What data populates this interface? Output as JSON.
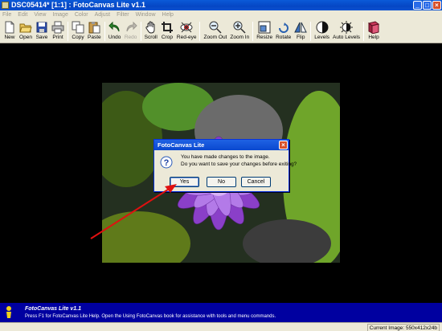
{
  "window": {
    "title": "DSC05414* [1:1] : FotoCanvas Lite v1.1",
    "buttons": [
      "_",
      "□",
      "×"
    ]
  },
  "menu": [
    "File",
    "Edit",
    "View",
    "Image",
    "Color",
    "Adjust",
    "Filter",
    "Window",
    "Help"
  ],
  "toolbar": [
    {
      "label": "New",
      "icon": "new-document-icon"
    },
    {
      "label": "Open",
      "icon": "open-folder-icon"
    },
    {
      "label": "Save",
      "icon": "floppy-disk-icon"
    },
    {
      "label": "Print",
      "icon": "printer-icon"
    },
    {
      "label": "Copy",
      "icon": "copy-icon"
    },
    {
      "label": "Paste",
      "icon": "paste-icon"
    },
    {
      "label": "Undo",
      "icon": "undo-arrow-icon"
    },
    {
      "label": "Redo",
      "icon": "redo-arrow-icon",
      "disabled": true
    },
    {
      "label": "Scroll",
      "icon": "hand-icon"
    },
    {
      "label": "Crop",
      "icon": "crop-icon"
    },
    {
      "label": "Red-eye",
      "icon": "red-eye-icon"
    },
    {
      "label": "Zoom Out",
      "icon": "zoom-out-icon"
    },
    {
      "label": "Zoom In",
      "icon": "zoom-in-icon"
    },
    {
      "label": "Resize",
      "icon": "resize-icon"
    },
    {
      "label": "Rotate",
      "icon": "rotate-icon"
    },
    {
      "label": "Flip",
      "icon": "flip-icon"
    },
    {
      "label": "Levels",
      "icon": "levels-icon"
    },
    {
      "label": "Auto Levels",
      "icon": "auto-levels-icon"
    },
    {
      "label": "Help",
      "icon": "help-book-icon"
    }
  ],
  "dialog": {
    "title": "FotoCanvas Lite",
    "message_line1": "You have made changes to the image.",
    "message_line2": "Do you want to save your changes before exiting?",
    "yes": "Yes",
    "no": "No",
    "cancel": "Cancel",
    "icon": "question-icon"
  },
  "help_panel": {
    "title": "FotoCanvas Lite v1.1",
    "text": "Press F1 for FotoCanvas Lite Help.  Open the Using FotoCanvas book for assistance with tools and menu commands."
  },
  "status": {
    "text": "Current Image: 550x412x24b"
  },
  "colors": {
    "accent": "#0000a0",
    "titlebar": "#0a52d0",
    "annotation_arrow": "#e01010"
  }
}
